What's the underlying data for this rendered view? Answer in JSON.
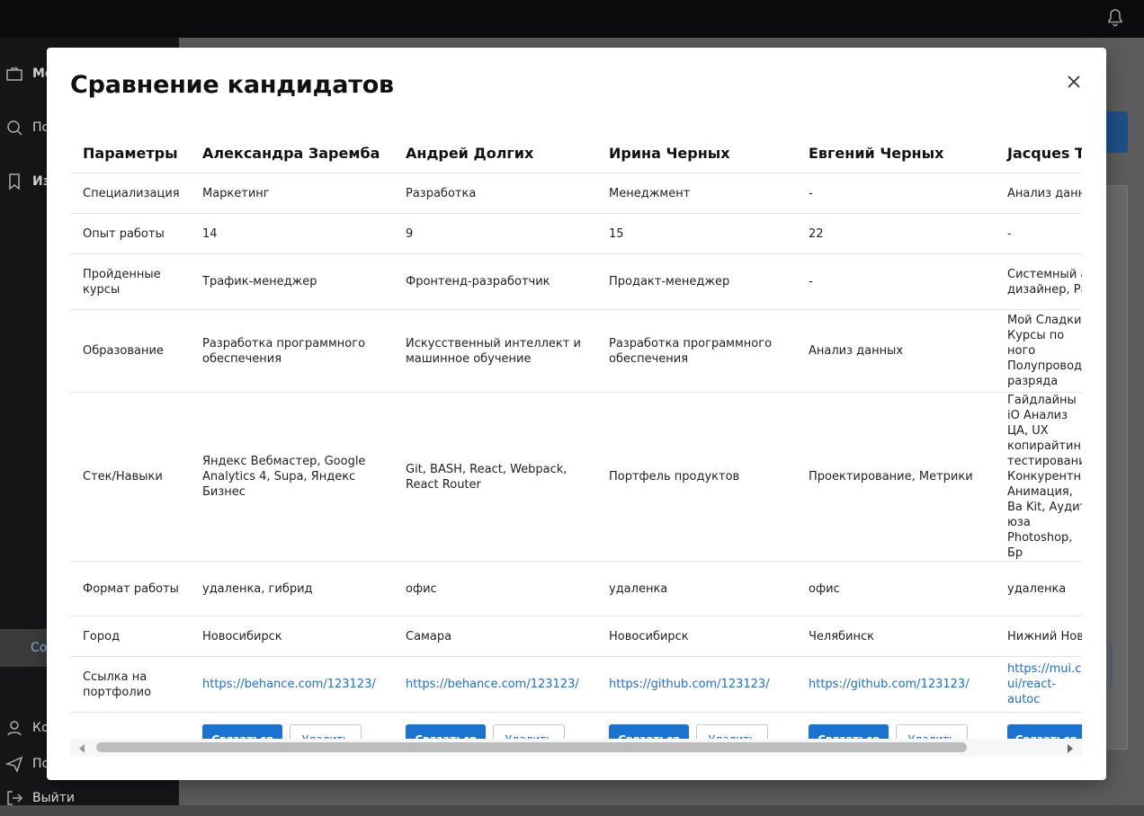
{
  "modal": {
    "title": "Сравнение кандидатов"
  },
  "table": {
    "params_header": "Параметры",
    "rows": [
      {
        "label": "Специализация"
      },
      {
        "label": "Опыт работы"
      },
      {
        "label": "Пройденные курсы"
      },
      {
        "label": "Образование"
      },
      {
        "label": "Стек/Навыки"
      },
      {
        "label": "Формат работы"
      },
      {
        "label": "Город"
      },
      {
        "label": "Ссылка на портфолио"
      }
    ],
    "candidates": [
      {
        "name": "Александра Заремба",
        "specialization": "Маркетинг",
        "experience": "14",
        "courses": "Трафик-менеджер",
        "education": "Разработка программного обеспечения",
        "skills": "Яндекс Вебмастер, Google Analytics 4, Supa, Яндекс Бизнес",
        "format": "удаленка, гибрид",
        "city": "Новосибирск",
        "portfolio": "https://behance.com/123123/"
      },
      {
        "name": "Андрей Долгих",
        "specialization": "Разработка",
        "experience": "9",
        "courses": "Фронтенд-разработчик",
        "education": "Искусственный интеллект и машинное обучение",
        "skills": "Git, BASH, React, Webpack, React Router",
        "format": "офис",
        "city": "Самара",
        "portfolio": "https://behance.com/123123/"
      },
      {
        "name": "Ирина Черных",
        "specialization": "Менеджмент",
        "experience": "15",
        "courses": "Продакт-менеджер",
        "education": "Разработка программного обеспечения",
        "skills": "Портфель продуктов",
        "format": "удаленка",
        "city": "Новосибирск",
        "portfolio": "https://github.com/123123/"
      },
      {
        "name": "Евгений Черных",
        "specialization": "-",
        "experience": "22",
        "courses": "-",
        "education": "Анализ данных",
        "skills": "Проектирование, Метрики",
        "format": "офис",
        "city": "Челябинск",
        "portfolio": "https://github.com/123123/"
      },
      {
        "name": "Jacques Te",
        "specialization": "Анализ данны",
        "experience": "-",
        "courses": "Системный ан дизайнер, Раз",
        "education": "Мой Сладкий Курсы по ного Полупроводн разряда",
        "skills": "Гайдлайны iO Анализ ЦА, UX копирайтинг, тестирование Конкурентны Анимация, Ва Kit, Аудит юза Photoshop, Бр",
        "format": "удаленка",
        "city": "Нижний Новг",
        "portfolio": "https://mui.co ui/react-autoc"
      }
    ]
  },
  "actions": {
    "contact_label": "Связаться",
    "delete_label": "Удалить"
  },
  "background": {
    "sidebar_items": [
      "Ме",
      "По",
      "Из",
      "Со",
      "Ко",
      "По",
      "Выйти"
    ]
  }
}
